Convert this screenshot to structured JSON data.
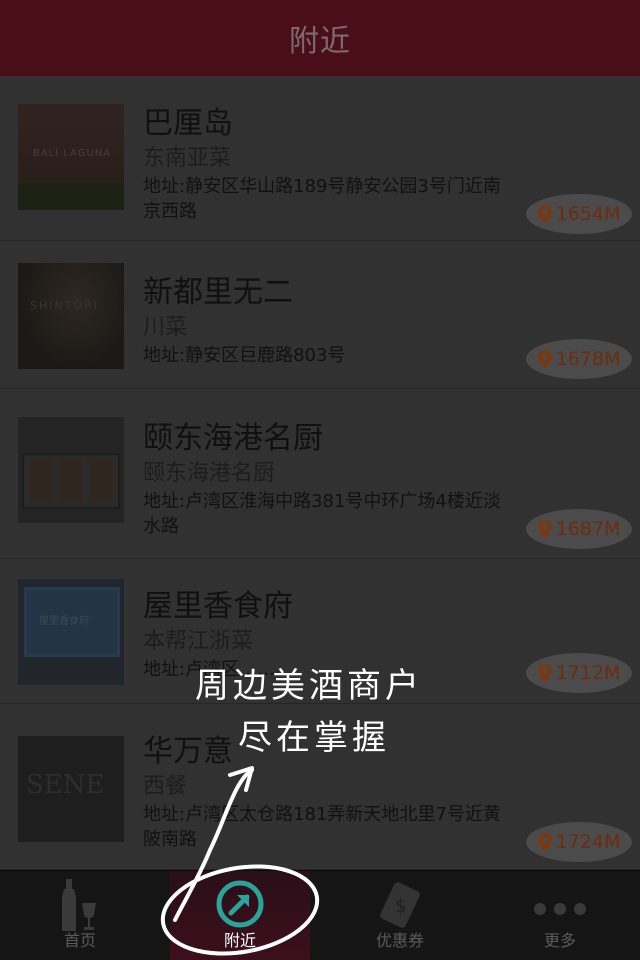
{
  "header": {
    "title": "附近"
  },
  "restaurants": [
    {
      "name": "巴厘岛",
      "cuisine": "东南亚菜",
      "address": "地址:静安区华山路189号静安公园3号门近南京西路",
      "distance": "1654M",
      "thumb_text": "BALI LAGUNA"
    },
    {
      "name": "新都里无二",
      "cuisine": "川菜",
      "address": "地址:静安区巨鹿路803号",
      "distance": "1678M",
      "thumb_text": "SHINTORI"
    },
    {
      "name": "颐东海港名厨",
      "cuisine": "颐东海港名厨",
      "address": "地址:卢湾区淮海中路381号中环广场4楼近淡水路",
      "distance": "1687M"
    },
    {
      "name": "屋里香食府",
      "cuisine": "本帮江浙菜",
      "address": "地址:卢湾区……",
      "distance": "1712M"
    },
    {
      "name": "华万意",
      "cuisine": "西餐",
      "address": "地址:卢湾区太仓路181弄新天地北里7号近黄陂南路",
      "distance": "1724M",
      "thumb_text": "SENE"
    }
  ],
  "tabs": [
    {
      "label": "首页",
      "icon": "wine-bottle-icon"
    },
    {
      "label": "附近",
      "icon": "compass-arrow-icon",
      "active": true
    },
    {
      "label": "优惠券",
      "icon": "coupon-icon"
    },
    {
      "label": "更多",
      "icon": "more-dots-icon"
    }
  ],
  "overlay": {
    "line1": "周边美酒商户",
    "line2": "尽在掌握"
  },
  "colors": {
    "header_bg": "#4a0e18",
    "distance_text": "#6b2d0c",
    "pin": "#7a3810"
  }
}
